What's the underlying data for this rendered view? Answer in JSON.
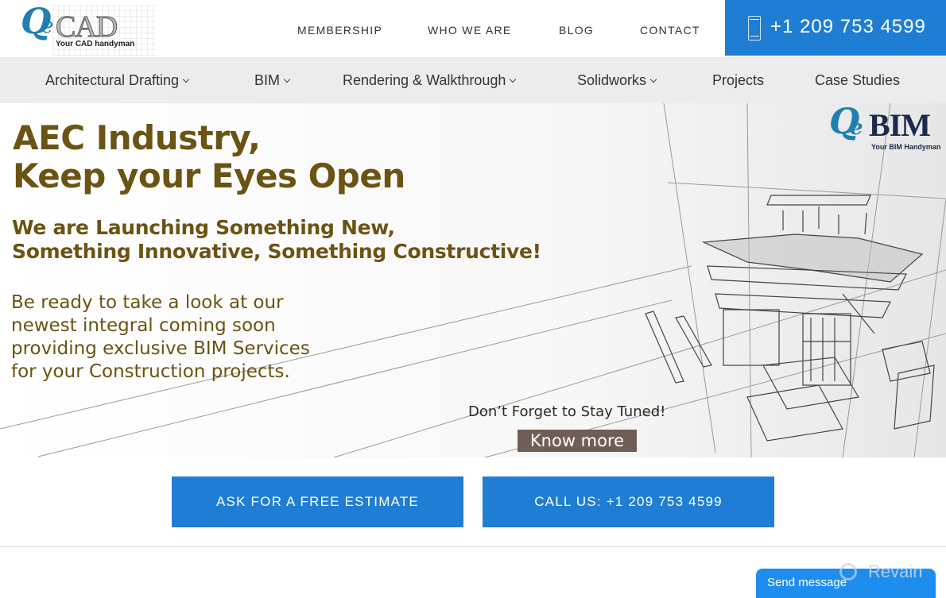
{
  "header": {
    "logo": {
      "mark": "Q",
      "mark_e": "e",
      "name": "CAD",
      "tagline": "Your CAD handyman"
    },
    "nav": [
      {
        "label": "MEMBERSHIP"
      },
      {
        "label": "WHO WE ARE"
      },
      {
        "label": "BLOG"
      },
      {
        "label": "CONTACT"
      }
    ],
    "phone": {
      "icon": "smartphone-icon",
      "number": "+1 209 753 4599"
    }
  },
  "subnav": {
    "items": [
      {
        "label": "Architectural Drafting",
        "has_dropdown": true
      },
      {
        "label": "BIM",
        "has_dropdown": true
      },
      {
        "label": "Rendering & Walkthrough",
        "has_dropdown": true
      },
      {
        "label": "Solidworks",
        "has_dropdown": true
      },
      {
        "label": "Projects",
        "has_dropdown": false
      },
      {
        "label": "Case Studies",
        "has_dropdown": false
      }
    ]
  },
  "hero": {
    "headline_line1": "AEC Industry,",
    "headline_line2": "Keep your Eyes Open",
    "subhead_line1": "We are Launching Something New,",
    "subhead_line2": "Something Innovative, Something Constructive!",
    "body_lines": [
      "Be ready to take a look at our",
      "newest integral coming soon",
      "providing exclusive BIM Services",
      "for your Construction projects."
    ],
    "stay_tuned": "Don’t Forget to Stay Tuned!",
    "know_more": "Know more",
    "bim_logo": {
      "mark": "Q",
      "mark_e": "e",
      "name": "BIM",
      "tagline": "Your BIM Handyman"
    }
  },
  "cta": {
    "estimate": "ASK FOR A FREE ESTIMATE",
    "call": "CALL US: +1 209 753 4599"
  },
  "chat": {
    "label": "Send message"
  },
  "watermark": {
    "text": "Revain"
  },
  "colors": {
    "brand_blue": "#1f7ed4",
    "headline_brown": "#6b5312",
    "know_more_bg": "#6f5e55",
    "subnav_bg": "#ececec"
  }
}
